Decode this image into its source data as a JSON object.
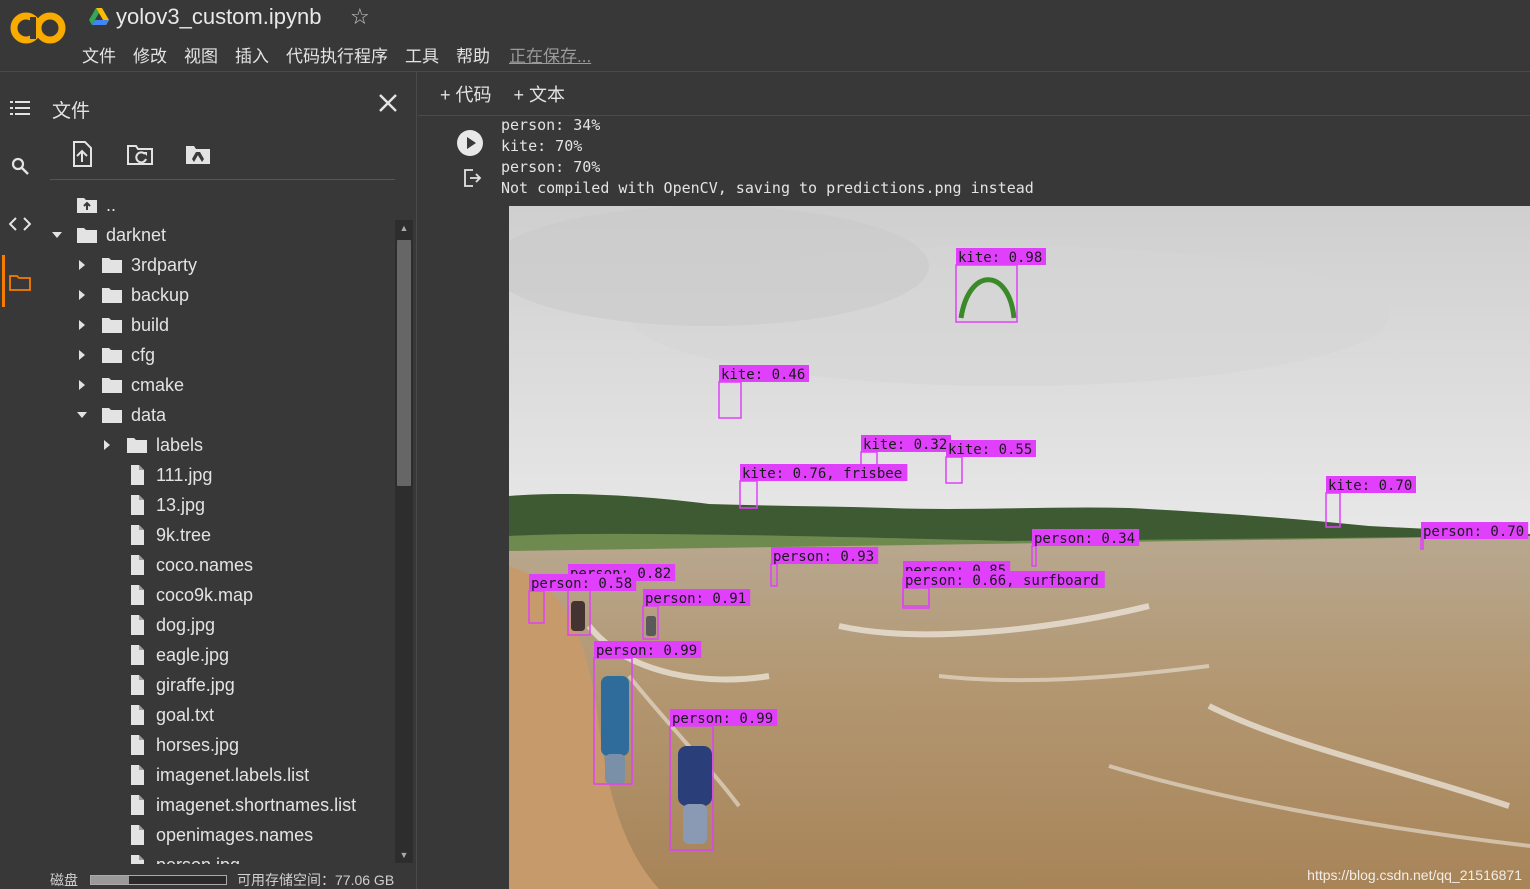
{
  "header": {
    "logo_text": "CO",
    "notebook_title": "yolov3_custom.ipynb",
    "star_glyph": "☆",
    "menus": [
      "文件",
      "修改",
      "视图",
      "插入",
      "代码执行程序",
      "工具",
      "帮助"
    ],
    "saving_status": "正在保存..."
  },
  "rail": {
    "icons": [
      "toc-icon",
      "search-icon",
      "code-snippets-icon",
      "folder-icon"
    ],
    "active": "folder-icon",
    "accent_color": "#f57c00"
  },
  "files": {
    "title": "文件",
    "tools": [
      "upload-icon",
      "refresh-folder-icon",
      "drive-folder-icon"
    ],
    "tree": [
      {
        "name": "..",
        "type": "up",
        "depth": 0
      },
      {
        "name": "darknet",
        "type": "folder",
        "depth": 0,
        "expanded": true
      },
      {
        "name": "3rdparty",
        "type": "folder",
        "depth": 1,
        "expanded": false
      },
      {
        "name": "backup",
        "type": "folder",
        "depth": 1,
        "expanded": false
      },
      {
        "name": "build",
        "type": "folder",
        "depth": 1,
        "expanded": false
      },
      {
        "name": "cfg",
        "type": "folder",
        "depth": 1,
        "expanded": false
      },
      {
        "name": "cmake",
        "type": "folder",
        "depth": 1,
        "expanded": false
      },
      {
        "name": "data",
        "type": "folder",
        "depth": 1,
        "expanded": true
      },
      {
        "name": "labels",
        "type": "folder",
        "depth": 2,
        "expanded": false
      },
      {
        "name": "111.jpg",
        "type": "file",
        "depth": 2
      },
      {
        "name": "13.jpg",
        "type": "file",
        "depth": 2
      },
      {
        "name": "9k.tree",
        "type": "file",
        "depth": 2
      },
      {
        "name": "coco.names",
        "type": "file",
        "depth": 2
      },
      {
        "name": "coco9k.map",
        "type": "file",
        "depth": 2
      },
      {
        "name": "dog.jpg",
        "type": "file",
        "depth": 2
      },
      {
        "name": "eagle.jpg",
        "type": "file",
        "depth": 2
      },
      {
        "name": "giraffe.jpg",
        "type": "file",
        "depth": 2
      },
      {
        "name": "goal.txt",
        "type": "file",
        "depth": 2
      },
      {
        "name": "horses.jpg",
        "type": "file",
        "depth": 2
      },
      {
        "name": "imagenet.labels.list",
        "type": "file",
        "depth": 2
      },
      {
        "name": "imagenet.shortnames.list",
        "type": "file",
        "depth": 2
      },
      {
        "name": "openimages.names",
        "type": "file",
        "depth": 2
      },
      {
        "name": "person.jpg",
        "type": "file",
        "depth": 2
      }
    ],
    "disk_label": "磁盘",
    "disk_available": "可用存储空间：77.06 GB",
    "disk_used_fraction": 0.28
  },
  "toolbar": {
    "add_code": "+ 代码",
    "add_text": "+ 文本"
  },
  "cell": {
    "output_lines": [
      "person: 34%",
      "kite: 70%",
      "person: 70%",
      "Not compiled with OpenCV, saving to predictions.png instead"
    ],
    "detections": [
      {
        "label": "kite: 0.98"
      },
      {
        "label": "kite: 0.46"
      },
      {
        "label": "kite: 0.32"
      },
      {
        "label": "kite: 0.55"
      },
      {
        "label": "kite: 0.76, frisbee"
      },
      {
        "label": "kite: 0.70"
      },
      {
        "label": "person: 0.34"
      },
      {
        "label": "person: 0.70"
      },
      {
        "label": "person: 0.93"
      },
      {
        "label": "person: 0.85"
      },
      {
        "label": "person: 0.66, surfboard"
      },
      {
        "label": "person: 0.82"
      },
      {
        "label": "person: 0.58"
      },
      {
        "label": "person: 0.91"
      },
      {
        "label": "person: 0.99"
      },
      {
        "label": "person: 0.99"
      }
    ],
    "box_color": "#e040fb",
    "watermark": "https://blog.csdn.net/qq_21516871"
  }
}
